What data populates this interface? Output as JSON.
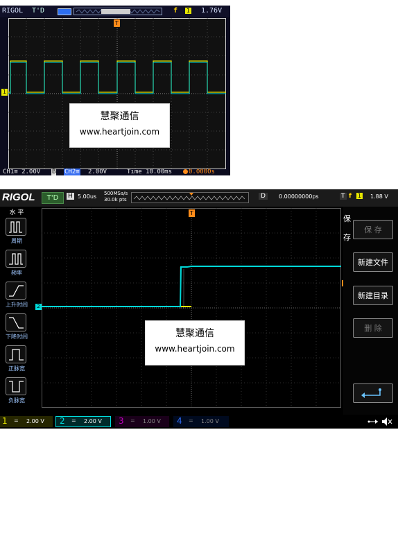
{
  "scope1": {
    "brand": "RIGOL",
    "trig_status": "T'D",
    "trigger_level": "1.76V",
    "trigger_channel": "1",
    "trigger_slope": "f",
    "ch1": "CH1≡  2.00V",
    "ch1_suffix": "B",
    "ch2_label": "CH2≡",
    "ch2_value": "2.00V",
    "time": "Time 10.00ms",
    "time_offset": "0.0000s",
    "ch1_marker": "1",
    "trig_marker": "T"
  },
  "scope2": {
    "brand": "RIGOL",
    "trig_status": "T'D",
    "h_label": "H",
    "timebase": "5.00us",
    "sample_rate": "500MSa/s",
    "mem_depth": "30.0k pts",
    "d_label": "D",
    "delay": "0.00000000ps",
    "t_label": "T",
    "trigger_slope": "f",
    "trigger_channel": "1",
    "trigger_level": "1.88 V",
    "left_menu": {
      "title": "水 平",
      "items": [
        "周期",
        "频率",
        "上升时间",
        "下降时间",
        "正脉宽",
        "负脉宽"
      ]
    },
    "right_menu": {
      "title_line1": "保",
      "title_line2": "存",
      "buttons": [
        "保 存",
        "新建文件",
        "新建目录",
        "删 除"
      ]
    },
    "channels": [
      {
        "num": "1",
        "value": "2.00 V",
        "color": "#e8e800"
      },
      {
        "num": "2",
        "value": "2.00 V",
        "color": "#00e0e0"
      },
      {
        "num": "3",
        "value": "1.00 V",
        "color": "#c000c0"
      },
      {
        "num": "4",
        "value": "1.00 V",
        "color": "#3070ff"
      }
    ],
    "ch_coupling": "=",
    "ch2_marker": "2",
    "trig_marker": "T"
  },
  "watermark": {
    "line1": "慧聚通信",
    "line2": "www.heartjoin.com"
  }
}
